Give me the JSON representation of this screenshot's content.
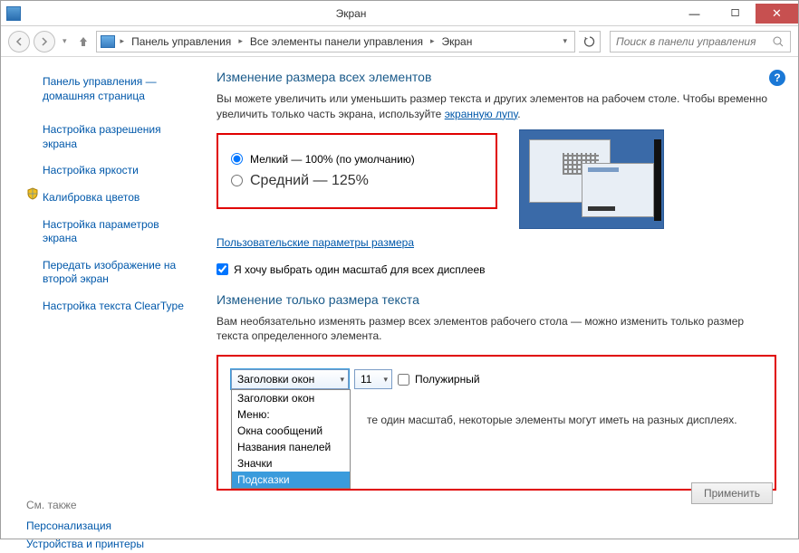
{
  "window": {
    "title": "Экран"
  },
  "breadcrumb": {
    "items": [
      "Панель управления",
      "Все элементы панели управления",
      "Экран"
    ]
  },
  "search": {
    "placeholder": "Поиск в панели управления"
  },
  "sidebar": {
    "items": [
      "Панель управления — домашняя страница",
      "Настройка разрешения экрана",
      "Настройка яркости",
      "Калибровка цветов",
      "Настройка параметров экрана",
      "Передать изображение на второй экран",
      "Настройка текста ClearType"
    ]
  },
  "see_also": {
    "header": "См. также",
    "items": [
      "Персонализация",
      "Устройства и принтеры"
    ]
  },
  "main": {
    "section1_title": "Изменение размера всех элементов",
    "section1_desc1": "Вы можете увеличить или уменьшить размер текста и других элементов на рабочем столе. Чтобы временно увеличить только часть экрана, используйте ",
    "section1_link": "экранную лупу",
    "section1_desc2": ".",
    "radio_small": "Мелкий — 100% (по умолчанию)",
    "radio_medium": "Средний — 125%",
    "custom_link": "Пользовательские параметры размера",
    "one_scale_checkbox": "Я хочу выбрать один масштаб для всех дисплеев",
    "section2_title": "Изменение только размера текста",
    "section2_desc": "Вам необязательно изменять размер всех элементов рабочего стола — можно изменить только размер текста определенного элемента.",
    "element_selected": "Заголовки окон",
    "size_selected": "11",
    "bold_label": "Полужирный",
    "dropdown_options": [
      "Заголовки окон",
      "Меню:",
      "Окна сообщений",
      "Названия панелей",
      "Значки",
      "Подсказки"
    ],
    "note_text": "те один масштаб, некоторые элементы могут иметь на разных дисплеях.",
    "apply_label": "Применить"
  }
}
